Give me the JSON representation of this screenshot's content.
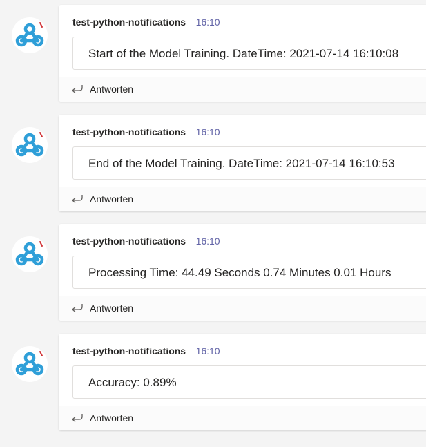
{
  "accent_color": "#6264a7",
  "webhook_icon_color": "#2f9fd8",
  "messages": [
    {
      "sender": "test-python-notifications",
      "time": "16:10",
      "text": "Start of the Model Training. DateTime: 2021-07-14 16:10:08",
      "reply_label": "Antworten"
    },
    {
      "sender": "test-python-notifications",
      "time": "16:10",
      "text": "End of the Model Training. DateTime: 2021-07-14 16:10:53",
      "reply_label": "Antworten"
    },
    {
      "sender": "test-python-notifications",
      "time": "16:10",
      "text": "Processing Time: 44.49 Seconds 0.74 Minutes 0.01 Hours",
      "reply_label": "Antworten"
    },
    {
      "sender": "test-python-notifications",
      "time": "16:10",
      "text": "Accuracy: 0.89%",
      "reply_label": "Antworten"
    }
  ]
}
